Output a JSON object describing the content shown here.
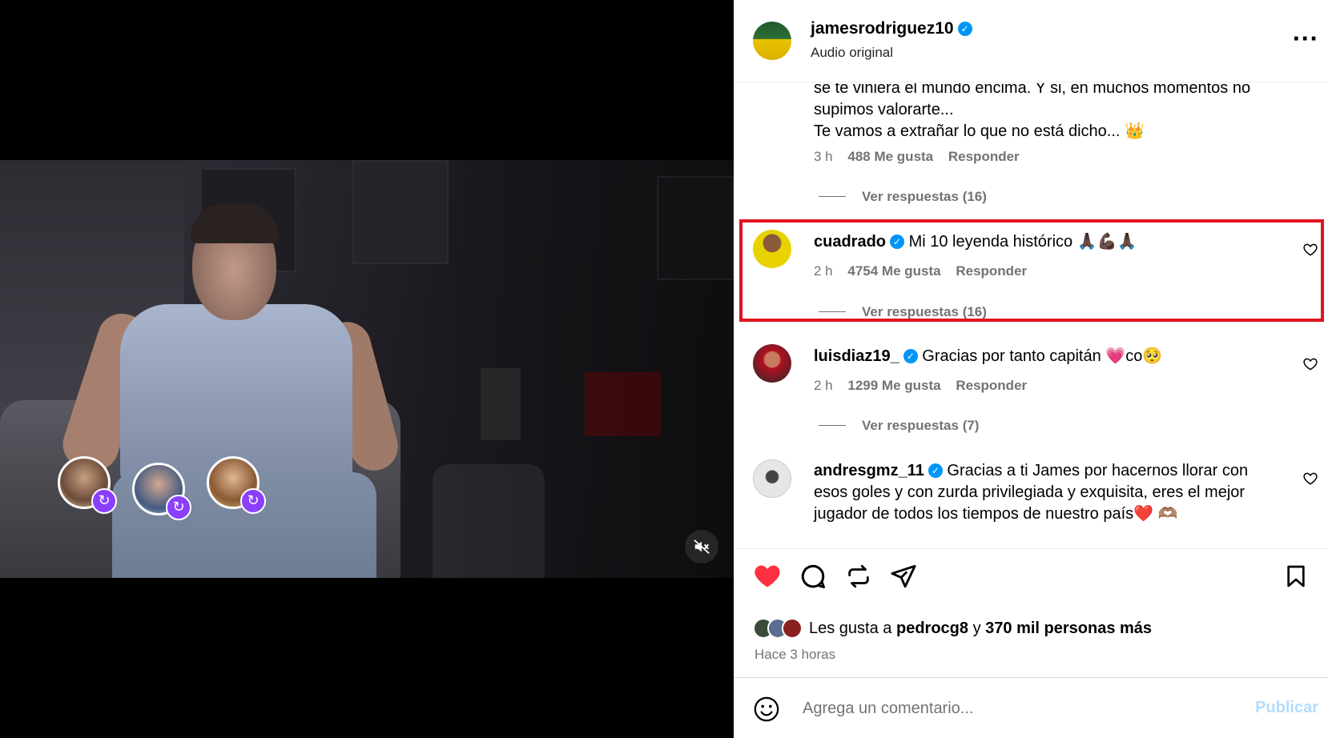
{
  "colors": {
    "verified": "#0095f6",
    "like_red": "#ff3040",
    "highlight": "#e0141e",
    "collab_badge": "#8a3ffc",
    "muted_text": "#737373",
    "publish_disabled": "#b3dbff"
  },
  "video": {
    "collaborator_icons": [
      "collab-avatar-1",
      "collab-avatar-2",
      "collab-avatar-3"
    ],
    "mute_icon": "speaker-muted-icon"
  },
  "post": {
    "author": "jamesrodriguez10",
    "audio": "Audio original",
    "more_icon": "more-dots-icon"
  },
  "comments": [
    {
      "text_lines": [
        "se te viniera el mundo encima. Y si, en muchos momentos no",
        "supimos valorarte...",
        "Te vamos a extrañar lo que no está dicho... 👑"
      ],
      "time": "3 h",
      "likes": "488 Me gusta",
      "reply": "Responder",
      "view_replies": "Ver respuestas (16)"
    },
    {
      "user": "cuadrado",
      "text": "Mi 10 leyenda histórico 🙏🏿💪🏿🙏🏿",
      "time": "2 h",
      "likes": "4754 Me gusta",
      "reply": "Responder",
      "view_replies": "Ver respuestas (16)"
    },
    {
      "user": "luisdiaz19_",
      "text": "Gracias por tanto capitán 💗co🥺",
      "time": "2 h",
      "likes": "1299 Me gusta",
      "reply": "Responder",
      "view_replies": "Ver respuestas (7)"
    },
    {
      "user": "andresgmz_11",
      "text_lines": [
        "Gracias a ti James por hacernos llorar con",
        "esos goles y con zurda privilegiada y exquisita, eres el mejor",
        "jugador de todos los tiempos de nuestro país❤️ 🫶🏽"
      ]
    }
  ],
  "likes_summary": {
    "prefix": "Les gusta a",
    "user": "pedrocg8",
    "joiner": "y",
    "others": "370 mil personas más"
  },
  "time_ago": "Hace 3 horas",
  "comment_box": {
    "placeholder": "Agrega un comentario...",
    "publish": "Publicar"
  }
}
